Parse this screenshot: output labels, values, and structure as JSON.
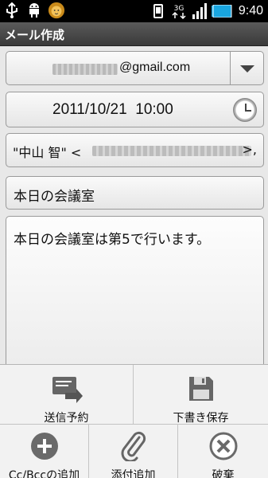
{
  "status_bar": {
    "time": "9:40",
    "network": "3G"
  },
  "title": "メール作成",
  "from": {
    "address_suffix": "@gmail.com"
  },
  "schedule": {
    "date": "2011/10/21",
    "time": "10:00"
  },
  "to": {
    "name": "\"中山 智\" <",
    "suffix": ">,"
  },
  "subject": "本日の会議室",
  "body": "本日の会議室は第5で行います。",
  "menu": {
    "scheduled_send": "送信予約",
    "save_draft": "下書き保存",
    "add_cc_bcc": "Cc/Bccの追加",
    "add_attachment": "添付追加",
    "discard": "破棄"
  },
  "colors": {
    "status_bg": "#000000",
    "title_bg": "#4a4a4a",
    "battery": "#19a6e0"
  }
}
